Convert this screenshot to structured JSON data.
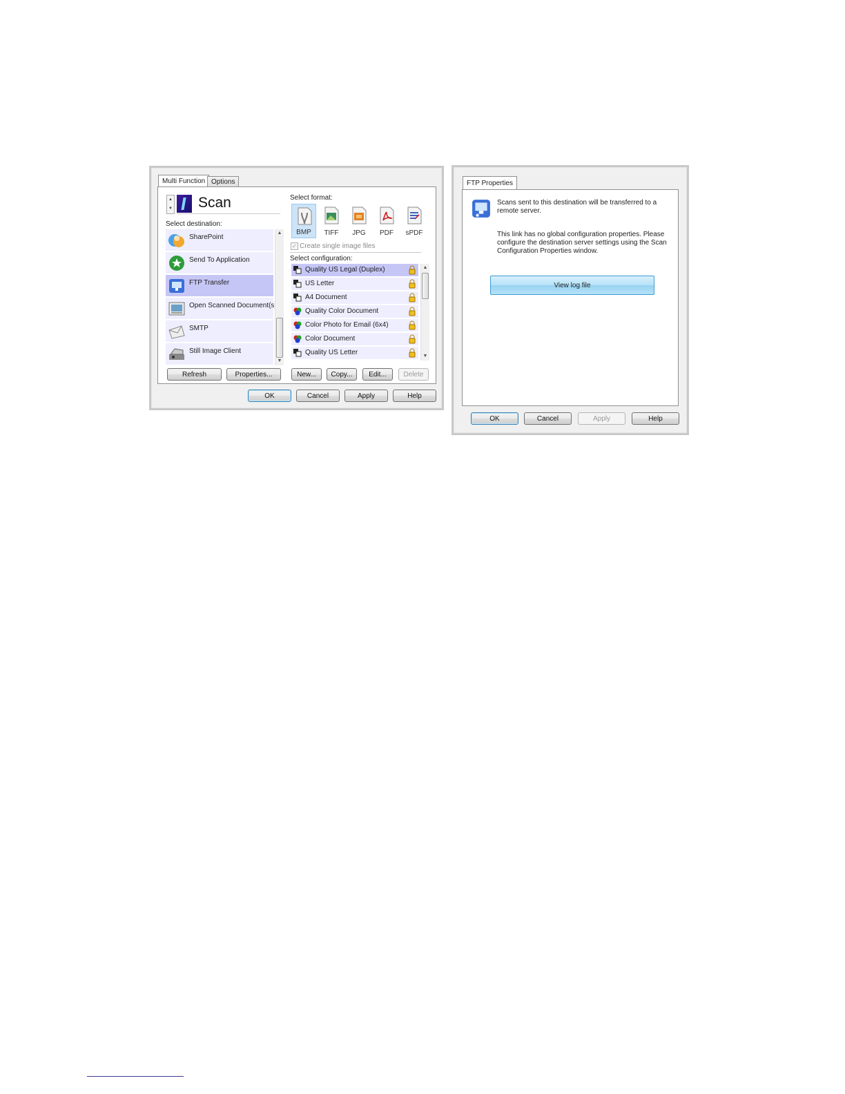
{
  "left_dialog": {
    "tabs": [
      "Multi Function",
      "Options"
    ],
    "mode_title": "Scan",
    "select_destination_label": "Select destination:",
    "destinations": [
      {
        "label": "SharePoint",
        "icon": "sharepoint-icon"
      },
      {
        "label": "Send To Application",
        "icon": "send-to-application-icon"
      },
      {
        "label": "FTP Transfer",
        "icon": "ftp-transfer-icon",
        "selected": true
      },
      {
        "label": "Open Scanned Document(s)",
        "icon": "open-document-icon"
      },
      {
        "label": "SMTP",
        "icon": "smtp-envelope-icon"
      },
      {
        "label": "Still Image Client",
        "icon": "still-image-client-icon"
      }
    ],
    "select_format_label": "Select format:",
    "formats": [
      {
        "label": "BMP",
        "selected": true
      },
      {
        "label": "TIFF"
      },
      {
        "label": "JPG"
      },
      {
        "label": "PDF"
      },
      {
        "label": "sPDF"
      }
    ],
    "create_single_image_files": "Create single image files",
    "select_configuration_label": "Select configuration:",
    "configurations": [
      {
        "label": "Quality US Legal (Duplex)",
        "selected": true,
        "color": false
      },
      {
        "label": "US Letter",
        "color": false
      },
      {
        "label": "A4 Document",
        "color": false
      },
      {
        "label": "Quality Color Document",
        "color": true
      },
      {
        "label": "Color Photo for Email (6x4)",
        "color": true
      },
      {
        "label": "Color Document",
        "color": true
      },
      {
        "label": "Quality US Letter",
        "color": false
      }
    ],
    "buttons": {
      "refresh": "Refresh",
      "properties": "Properties...",
      "new": "New...",
      "copy": "Copy...",
      "edit": "Edit...",
      "delete": "Delete",
      "ok": "OK",
      "cancel": "Cancel",
      "apply": "Apply",
      "help": "Help"
    }
  },
  "right_dialog": {
    "tab": "FTP Properties",
    "description": "Scans sent to this destination will be transferred to a remote server.",
    "note": "This link has no global configuration properties. Please configure the destination server settings using the Scan Configuration Properties window.",
    "view_log_button": "View log file",
    "buttons": {
      "ok": "OK",
      "cancel": "Cancel",
      "apply": "Apply",
      "help": "Help"
    }
  },
  "colors": {
    "list_item_bg": "#eeeeff",
    "list_item_selected": "#c6c6f6",
    "view_log_button": "#a8d8f0"
  }
}
